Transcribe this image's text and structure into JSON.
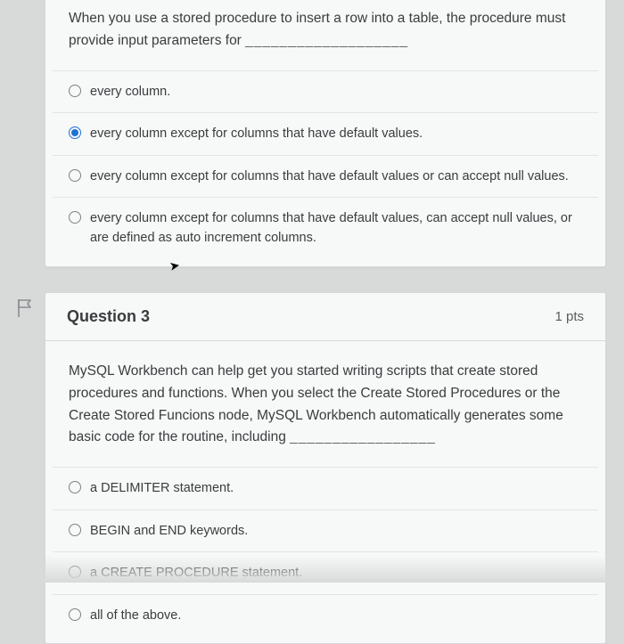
{
  "q2": {
    "stem_prefix": "When you use a stored procedure to insert a row into a table, the procedure must provide input parameters for ",
    "blank": "___________________",
    "options": [
      {
        "label": "every column."
      },
      {
        "label": "every column except for columns that have default values."
      },
      {
        "label": "every column except for columns that have default values or can accept null values."
      },
      {
        "label": "every column except for columns that have default values, can accept null values, or are defined as auto increment columns."
      }
    ],
    "selected_index": 1
  },
  "q3": {
    "title": "Question 3",
    "points": "1 pts",
    "stem_prefix": "MySQL Workbench can help get you started writing scripts that create stored procedures and functions. When you select the Create Stored Procedures or the Create Stored Funcions node, MySQL Workbench automatically generates some basic code for the routine, including ",
    "blank": "_________________",
    "options": [
      {
        "label": "a DELIMITER statement."
      },
      {
        "label": "BEGIN and END keywords."
      },
      {
        "label": "a CREATE PROCEDURE statement."
      },
      {
        "label": "all of the above."
      }
    ],
    "selected_index": -1
  }
}
